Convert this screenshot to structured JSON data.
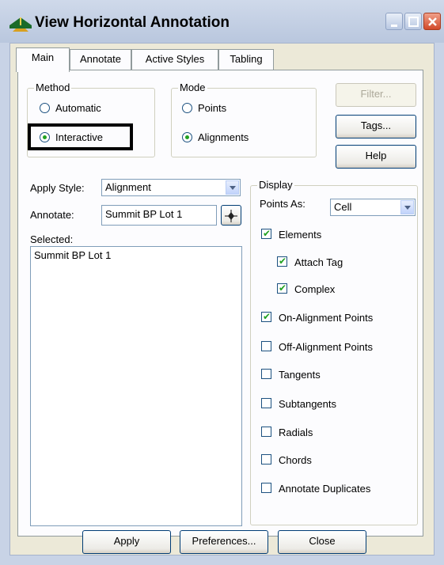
{
  "window": {
    "title": "View Horizontal Annotation",
    "title_icon": "bridge-road-icon"
  },
  "tabs": [
    {
      "label": "Main",
      "active": true
    },
    {
      "label": "Annotate",
      "active": false
    },
    {
      "label": "Active Styles",
      "active": false
    },
    {
      "label": "Tabling",
      "active": false
    }
  ],
  "method": {
    "label": "Method",
    "options": [
      {
        "label": "Automatic",
        "selected": false
      },
      {
        "label": "Interactive",
        "selected": true
      }
    ]
  },
  "mode": {
    "label": "Mode",
    "options": [
      {
        "label": "Points",
        "selected": false
      },
      {
        "label": "Alignments",
        "selected": true
      }
    ]
  },
  "side_buttons": {
    "filter": "Filter...",
    "tags": "Tags...",
    "help": "Help"
  },
  "apply_style": {
    "label": "Apply Style:",
    "value": "Alignment"
  },
  "annotate": {
    "label": "Annotate:",
    "value": "Summit BP Lot 1",
    "pick_icon": "crosshair-target-icon"
  },
  "selected": {
    "label": "Selected:",
    "items": [
      "Summit BP Lot 1"
    ]
  },
  "display": {
    "label": "Display",
    "points_as_label": "Points As:",
    "points_as_value": "Cell",
    "checkboxes": [
      {
        "label": "Elements",
        "checked": true
      },
      {
        "label": "Attach Tag",
        "checked": true
      },
      {
        "label": "Complex",
        "checked": true
      },
      {
        "label": "On-Alignment Points",
        "checked": true
      },
      {
        "label": "Off-Alignment Points",
        "checked": false
      },
      {
        "label": "Tangents",
        "checked": false
      },
      {
        "label": "Subtangents",
        "checked": false
      },
      {
        "label": "Radials",
        "checked": false
      },
      {
        "label": "Chords",
        "checked": false
      },
      {
        "label": "Annotate Duplicates",
        "checked": false
      }
    ]
  },
  "footer": {
    "apply": "Apply",
    "preferences": "Preferences...",
    "close": "Close"
  },
  "colors": {
    "titlebar": "#c0cce2",
    "close_button": "#d24a2a",
    "check_green": "#21a121"
  }
}
